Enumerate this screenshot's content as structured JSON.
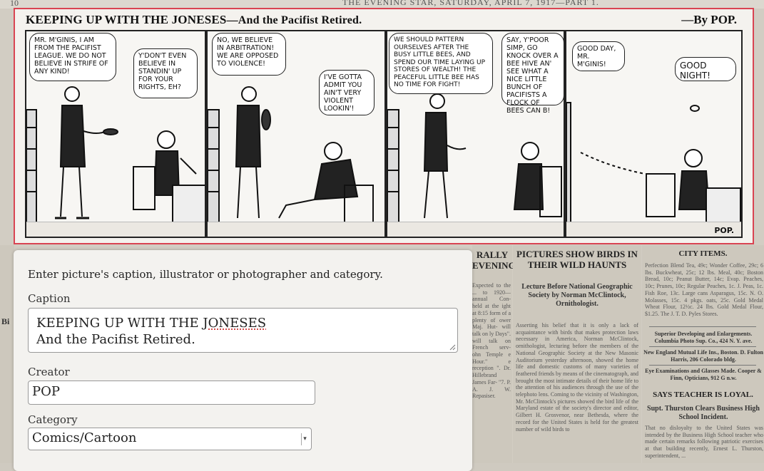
{
  "newspaper": {
    "page_number": "10",
    "header_line": "THE EVENING STAR, SATURDAY, APRIL 7, 1917—PART 1.",
    "comic": {
      "title": "KEEPING UP WITH THE JONESES",
      "subtitle": "—And the Pacifist Retired.",
      "author": "—By POP.",
      "signature": "POP.",
      "balloons": [
        "Mr. M'Ginis, I am from the Pacifist League. We do not believe in strife of any kind!",
        "Y'don't even believe in standin' up for your rights, eh?",
        "No, we believe in arbitration! We are opposed to violence!",
        "I've gotta admit you ain't very violent lookin'!",
        "We should pattern ourselves after the busy little bees, and spend our time laying up stores of wealth! The peaceful little bee has no time for fight!",
        "Say, y'poor simp, go knock over a bee hive an' see what a nice little bunch of pacifists a flock of bees can B!",
        "Good day, Mr. M'Ginis!",
        "Good night!"
      ]
    },
    "columns": {
      "col1_head": "RALLY EVENING",
      "col1_body": "Expected to the ... to 1920— annual Con- held at the ight at 8:15 form of a plenty of ower Maj. Hut- will talk on ly Days\". will talk on French serv- ohn Temple e Hour.\" e reception \". Dr. Hillebrand James Far- \"7. P. A. J. W. Repasiser.",
      "col2_head": "PICTURES SHOW BIRDS IN THEIR WILD HAUNTS",
      "col2_sub": "Lecture Before National Geographic Society by Norman McClintock, Ornithologist.",
      "col2_body": "Asserting his belief that it is only a lack of acquaintance with birds that makes protection laws necessary in America, Norman McClintock, ornithologist, lecturing before the members of the National Geographic Society at the New Masonic Auditorium yesterday afternoon, showed the home life and domestic customs of many varieties of feathered friends by means of the cinematograph, and brought the most intimate details of their home life to the attention of his audiences through the use of the telephoto lens. Coming to the vicinity of Washington, Mr. McClintock's pictures showed the bird life of the Maryland estate of the society's director and editor, Gilbert H. Grosvenor, near Bethesda, where the record for the United States is held for the greatest number of wild birds to",
      "col3_head": "CITY ITEMS.",
      "col3_body": "Perfection Blend Tea, 49c; Wonder Coffee, 29c; 6 lbs. Buckwheat, 25c; 12 lbs. Meal, 40c; Boston Bread, 10c; Peanut Butter, 14c; Evap. Peaches, 10c; Prunes, 10c; Regular Peaches, 1c. J. Peas, 1c. Fish Roe, 13c. Large cans Asparagus, 15c. N. O. Molasses, 15c. 4 pkgs. oats, 25c. Gold Medal Wheat Flour, 12½c. 24 lbs. Gold Medal Flour, $1.25. The J. T. D. Pyles Stores.",
      "col3_ad1": "Superior Developing and Enlargements. Columbia Photo Sup. Co., 424 N. Y. ave.",
      "col3_ad2": "New England Mutual Life Ins., Boston. D. Fulton Harris, 206 Colorado bldg.",
      "col3_ad3": "Eye Examinations and Glasses Made. Cooper & Finn, Opticians, 912 G n.w.",
      "col3_head2": "SAYS TEACHER IS LOYAL.",
      "col3_sub2": "Supt. Thurston Clears Business High School Incident.",
      "col3_body2": "That no disloyalty to the United States was intended by the Business High School teacher who made certain remarks following patriotic exercises at that building recently, Ernest L. Thurston, superintendent, ...",
      "left_frag": "Bi"
    }
  },
  "dialog": {
    "instructions": "Enter picture's caption, illustrator or photographer and category.",
    "caption_label": "Caption",
    "caption_line1_prefix": "KEEPING UP WITH THE ",
    "caption_line1_misspelled": "JONESES",
    "caption_line2": "And the Pacifist Retired.",
    "creator_label": "Creator",
    "creator_value": "POP",
    "category_label": "Category",
    "category_value": "Comics/Cartoon"
  }
}
